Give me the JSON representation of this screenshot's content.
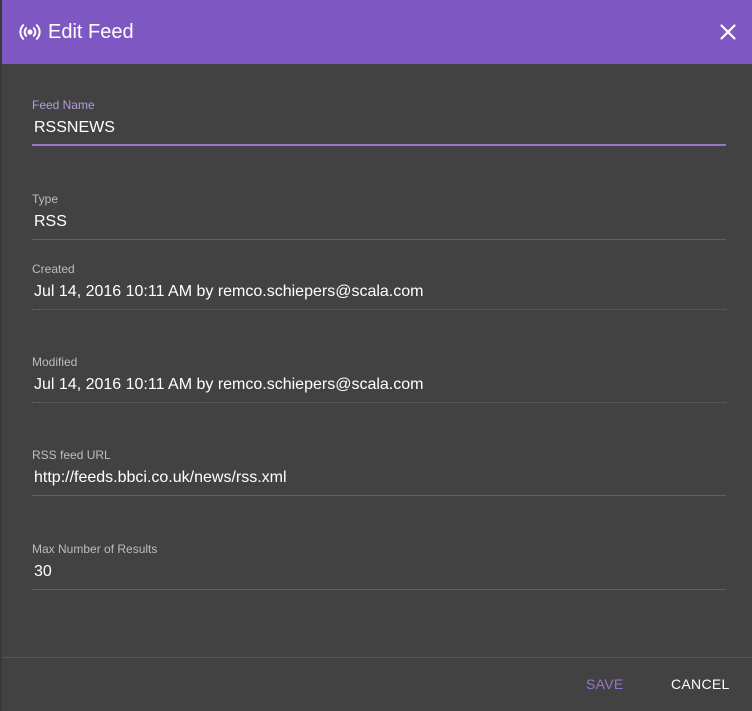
{
  "dialog": {
    "title": "Edit Feed",
    "header_icon": "broadcast-icon",
    "close_icon": "close-icon",
    "accent_color": "#7e57c2"
  },
  "fields": {
    "feed_name": {
      "label": "Feed Name",
      "value": "RSSNEWS"
    },
    "type": {
      "label": "Type",
      "value": "RSS"
    },
    "created": {
      "label": "Created",
      "value": "Jul 14, 2016 10:11 AM by remco.schiepers@scala.com"
    },
    "modified": {
      "label": "Modified",
      "value": "Jul 14, 2016 10:11 AM by remco.schiepers@scala.com"
    },
    "rss_url": {
      "label": "RSS feed URL",
      "value": "http://feeds.bbci.co.uk/news/rss.xml"
    },
    "max_results": {
      "label": "Max Number of Results",
      "value": "30"
    }
  },
  "footer": {
    "save_label": "SAVE",
    "cancel_label": "CANCEL"
  }
}
